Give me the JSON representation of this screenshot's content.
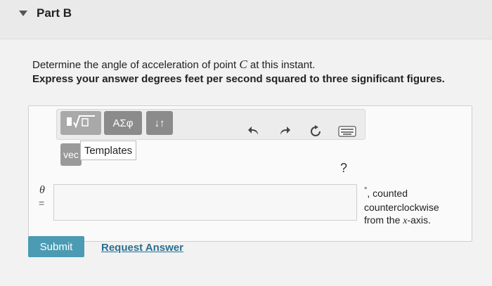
{
  "part": {
    "title": "Part B"
  },
  "question": {
    "text_before": "Determine the angle of acceleration of point ",
    "variable": "C",
    "text_after": " at this instant."
  },
  "instruction": "Express your answer degrees feet per second squared to three significant figures.",
  "toolbar": {
    "templates_icon": "radical-template-icon",
    "greek_label": "ΑΣφ",
    "arrows_label": "↓↑",
    "tooltip": "Templates",
    "vec_label": "vec",
    "undo_icon": "undo-icon",
    "redo_icon": "redo-icon",
    "reset_icon": "reset-icon",
    "keyboard_icon": "keyboard-icon",
    "help_label": "?"
  },
  "answer": {
    "variable": "θ",
    "equals": "=",
    "value": "",
    "unit_symbol": "°",
    "unit_line1": ", counted",
    "unit_line2": "counterclockwise",
    "unit_line3_before": "from the ",
    "unit_line3_var": "x",
    "unit_line3_after": "-axis."
  },
  "actions": {
    "submit": "Submit",
    "request": "Request Answer"
  }
}
